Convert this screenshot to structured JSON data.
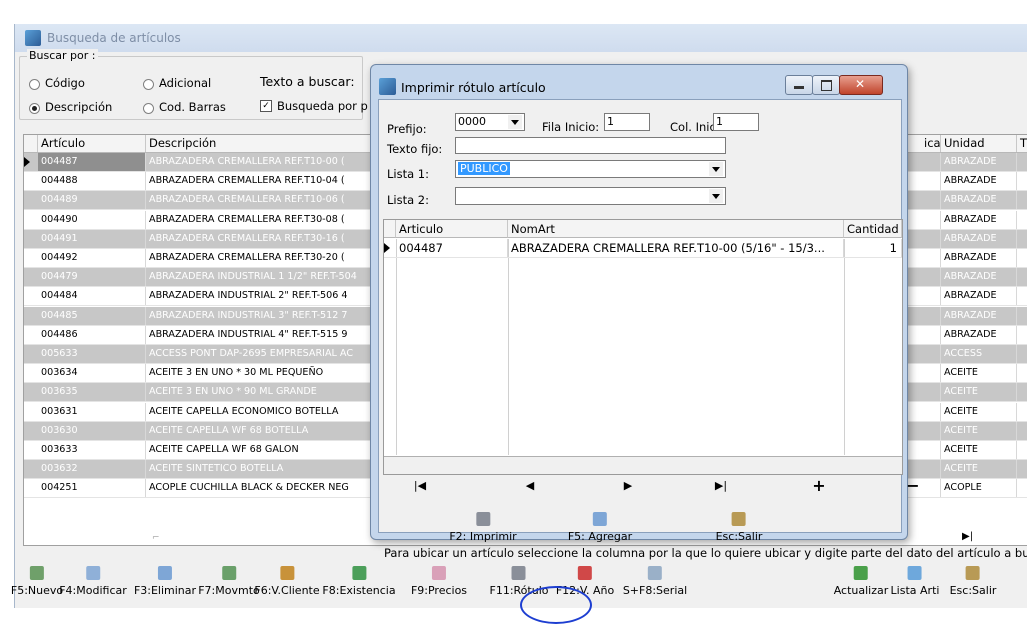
{
  "window": {
    "title": "Busqueda de artículos"
  },
  "search": {
    "group_label": "Buscar por :",
    "options": [
      {
        "label": "Código",
        "selected": false
      },
      {
        "label": "Adicional",
        "selected": false
      },
      {
        "label": "Descripción",
        "selected": true
      },
      {
        "label": "Cod. Barras",
        "selected": false
      }
    ],
    "text_label": "Texto a buscar:",
    "partial_label": "Busqueda por p",
    "partial_checked": true
  },
  "grid": {
    "columns": [
      "Artículo",
      "Descripción",
      "ica",
      "Unidad",
      "T"
    ],
    "rows": [
      {
        "articulo": "004487",
        "descripcion": "ABRAZADERA CREMALLERA REF.T10-00  (",
        "unidad": "ABRAZADE"
      },
      {
        "articulo": "004488",
        "descripcion": "ABRAZADERA CREMALLERA REF.T10-04  (",
        "unidad": "ABRAZADE"
      },
      {
        "articulo": "004489",
        "descripcion": "ABRAZADERA CREMALLERA REF.T10-06  (",
        "unidad": "ABRAZADE"
      },
      {
        "articulo": "004490",
        "descripcion": "ABRAZADERA CREMALLERA REF.T30-08  (",
        "unidad": "ABRAZADE"
      },
      {
        "articulo": "004491",
        "descripcion": "ABRAZADERA CREMALLERA REF.T30-16  (",
        "unidad": "ABRAZADE"
      },
      {
        "articulo": "004492",
        "descripcion": "ABRAZADERA CREMALLERA REF.T30-20  (",
        "unidad": "ABRAZADE"
      },
      {
        "articulo": "004479",
        "descripcion": "ABRAZADERA INDUSTRIAL 1 1/2\" REF.T-504",
        "unidad": "ABRAZADE"
      },
      {
        "articulo": "004484",
        "descripcion": "ABRAZADERA INDUSTRIAL 2\" REF.T-506  4",
        "unidad": "ABRAZADE"
      },
      {
        "articulo": "004485",
        "descripcion": "ABRAZADERA INDUSTRIAL 3\" REF.T-512  7",
        "unidad": "ABRAZADE"
      },
      {
        "articulo": "004486",
        "descripcion": "ABRAZADERA INDUSTRIAL 4\" REF.T-515  9",
        "unidad": "ABRAZADE"
      },
      {
        "articulo": "005633",
        "descripcion": "ACCESS PONT DAP-2695 EMPRESARIAL AC",
        "unidad": "ACCESS"
      },
      {
        "articulo": "003634",
        "descripcion": "ACEITE 3 EN UNO * 30 ML PEQUEÑO",
        "unidad": "ACEITE"
      },
      {
        "articulo": "003635",
        "descripcion": "ACEITE 3 EN UNO * 90 ML GRANDE",
        "unidad": "ACEITE"
      },
      {
        "articulo": "003631",
        "descripcion": "ACEITE CAPELLA ECONOMICO BOTELLA",
        "unidad": "ACEITE"
      },
      {
        "articulo": "003630",
        "descripcion": "ACEITE CAPELLA WF 68 BOTELLA",
        "unidad": "ACEITE"
      },
      {
        "articulo": "003633",
        "descripcion": "ACEITE CAPELLA WF 68 GALON",
        "unidad": "ACEITE"
      },
      {
        "articulo": "003632",
        "descripcion": "ACEITE SINTETICO BOTELLA",
        "unidad": "ACEITE"
      },
      {
        "articulo": "004251",
        "descripcion": "ACOPLE CUCHILLA BLACK & DECKER NEG",
        "unidad": "ACOPLE"
      }
    ],
    "hint": "Para ubicar un artículo seleccione la columna por la que lo quiere ubicar y digite parte del dato del artículo a buscar."
  },
  "toolbar": [
    {
      "label": "F5:Nuevo",
      "icon": "new-icon",
      "color": "#6fa06a"
    },
    {
      "label": "F4:Modificar",
      "icon": "edit-icon",
      "color": "#8fb0d8"
    },
    {
      "label": "F3:Eliminar",
      "icon": "delete-icon",
      "color": "#7ea6d6"
    },
    {
      "label": "F7:Movmto",
      "icon": "movement-icon",
      "color": "#6aa06a"
    },
    {
      "label": "F6:V.Cliente",
      "icon": "customer-icon",
      "color": "#c8923a"
    },
    {
      "label": "F8:Existencia",
      "icon": "stock-icon",
      "color": "#4c9f5a"
    },
    {
      "label": "F9:Precios",
      "icon": "price-icon",
      "color": "#d9a0b8"
    },
    {
      "label": "F11:Rótulo",
      "icon": "print-label-icon",
      "color": "#8a8f99"
    },
    {
      "label": "F12:V. Año",
      "icon": "year-chart-icon",
      "color": "#d04848"
    },
    {
      "label": "S+F8:Serial",
      "icon": "serial-icon",
      "color": "#9ab0c8"
    },
    {
      "label": "Actualizar",
      "icon": "refresh-icon",
      "color": "#4aa04a"
    },
    {
      "label": "Lista Arti",
      "icon": "list-icon",
      "color": "#6ea8dc"
    },
    {
      "label": "Esc:Salir",
      "icon": "exit-icon",
      "color": "#b89a55"
    }
  ],
  "dialog": {
    "title": "Imprimir rótulo artículo",
    "prefijo_label": "Prefijo:",
    "prefijo_value": "0000",
    "fila_label": "Fila Inicio:",
    "fila_value": "1",
    "col_label": "Col. Inicio:",
    "col_value": "1",
    "texto_label": "Texto fijo:",
    "texto_value": "",
    "lista1_label": "Lista 1:",
    "lista1_value": "PUBLICO",
    "lista2_label": "Lista 2:",
    "lista2_value": "",
    "grid_columns": [
      "Articulo",
      "NomArt",
      "Cantidad"
    ],
    "grid_rows": [
      {
        "articulo": "004487",
        "nomart": "ABRAZADERA CREMALLERA REF.T10-00  (5/16\" - 15/3...",
        "cantidad": "1"
      }
    ],
    "buttons": [
      {
        "label": "F2: Imprimir",
        "icon": "print-icon",
        "color": "#8a8f99"
      },
      {
        "label": "F5: Agregar",
        "icon": "add-icon",
        "color": "#7ea6d6"
      },
      {
        "label": "Esc:Salir",
        "icon": "exit-icon",
        "color": "#b89a55"
      }
    ]
  }
}
